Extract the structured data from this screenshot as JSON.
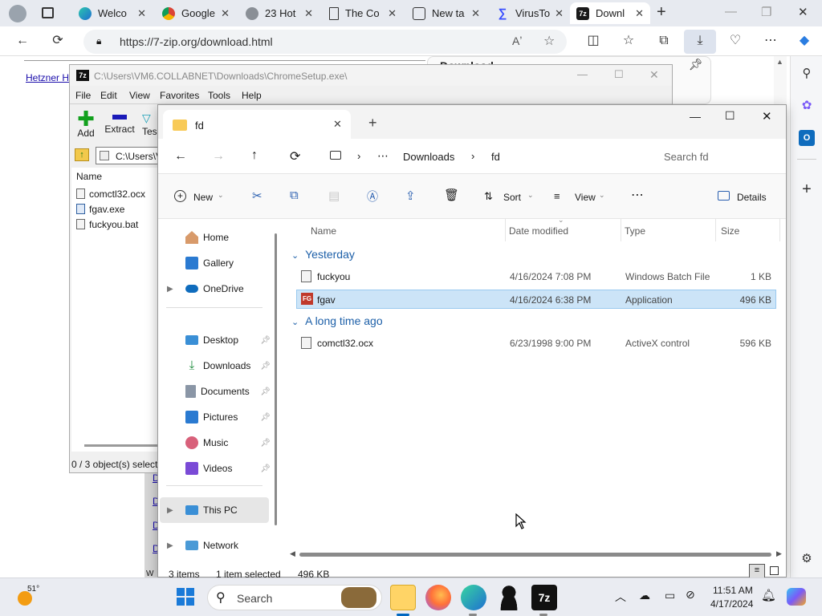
{
  "browser": {
    "tabs": [
      {
        "label": "",
        "icon": "profile-avatar-icon"
      },
      {
        "label": "",
        "icon": "tab-actions-icon"
      },
      {
        "label": "Welco",
        "icon": "edge-icon"
      },
      {
        "label": "Google",
        "icon": "chrome-icon"
      },
      {
        "label": "23 Hot",
        "icon": "wrench-icon"
      },
      {
        "label": "The Co",
        "icon": "document-icon"
      },
      {
        "label": "New ta",
        "icon": "newtab-icon"
      },
      {
        "label": "VirusTo",
        "icon": "virustotal-icon"
      },
      {
        "label": "Downl",
        "icon": "7zip-icon"
      }
    ],
    "url": "https://7-zip.org/download.html"
  },
  "webpage": {
    "link_left": "Hetzner H",
    "download_text": "Download",
    "side_links": [
      "D",
      "D",
      "D",
      "D"
    ],
    "bottom_text": "W"
  },
  "zip": {
    "title": "C:\\Users\\VM6.COLLABNET\\Downloads\\ChromeSetup.exe\\",
    "menu": [
      "File",
      "Edit",
      "View",
      "Favorites",
      "Tools",
      "Help"
    ],
    "toolbar": [
      "Add",
      "Extract",
      "Tes"
    ],
    "path": "C:\\Users\\V",
    "column_name": "Name",
    "files": [
      "comctl32.ocx",
      "fgav.exe",
      "fuckyou.bat"
    ],
    "status": "0 / 3 object(s) selecte"
  },
  "explorer": {
    "title": "fd",
    "breadcrumb": [
      "Downloads",
      "fd"
    ],
    "search_placeholder": "Search fd",
    "commands": {
      "new": "New",
      "sort": "Sort",
      "view": "View",
      "details": "Details"
    },
    "nav": {
      "home": "Home",
      "gallery": "Gallery",
      "onedrive": "OneDrive",
      "desktop": "Desktop",
      "downloads": "Downloads",
      "documents": "Documents",
      "pictures": "Pictures",
      "music": "Music",
      "videos": "Videos",
      "thispc": "This PC",
      "network": "Network"
    },
    "columns": {
      "name": "Name",
      "date": "Date modified",
      "type": "Type",
      "size": "Size"
    },
    "groups": {
      "yesterday": "Yesterday",
      "long_ago": "A long time ago"
    },
    "files": [
      {
        "name": "fuckyou",
        "date": "4/16/2024 7:08 PM",
        "type": "Windows Batch File",
        "size": "1 KB"
      },
      {
        "name": "fgav",
        "date": "4/16/2024 6:38 PM",
        "type": "Application",
        "size": "496 KB",
        "selected": true
      },
      {
        "name": "comctl32.ocx",
        "date": "6/23/1998 9:00 PM",
        "type": "ActiveX control",
        "size": "596 KB"
      }
    ],
    "status": {
      "items": "3 items",
      "selected": "1 item selected",
      "size": "496 KB"
    }
  },
  "taskbar": {
    "weather_temp": "51°",
    "search_label": "Search",
    "time": "11:51 AM",
    "date": "4/17/2024"
  },
  "colors": {
    "accent": "#0067c0",
    "selection": "#cce4f7",
    "taskbar": "#eaecf2"
  }
}
